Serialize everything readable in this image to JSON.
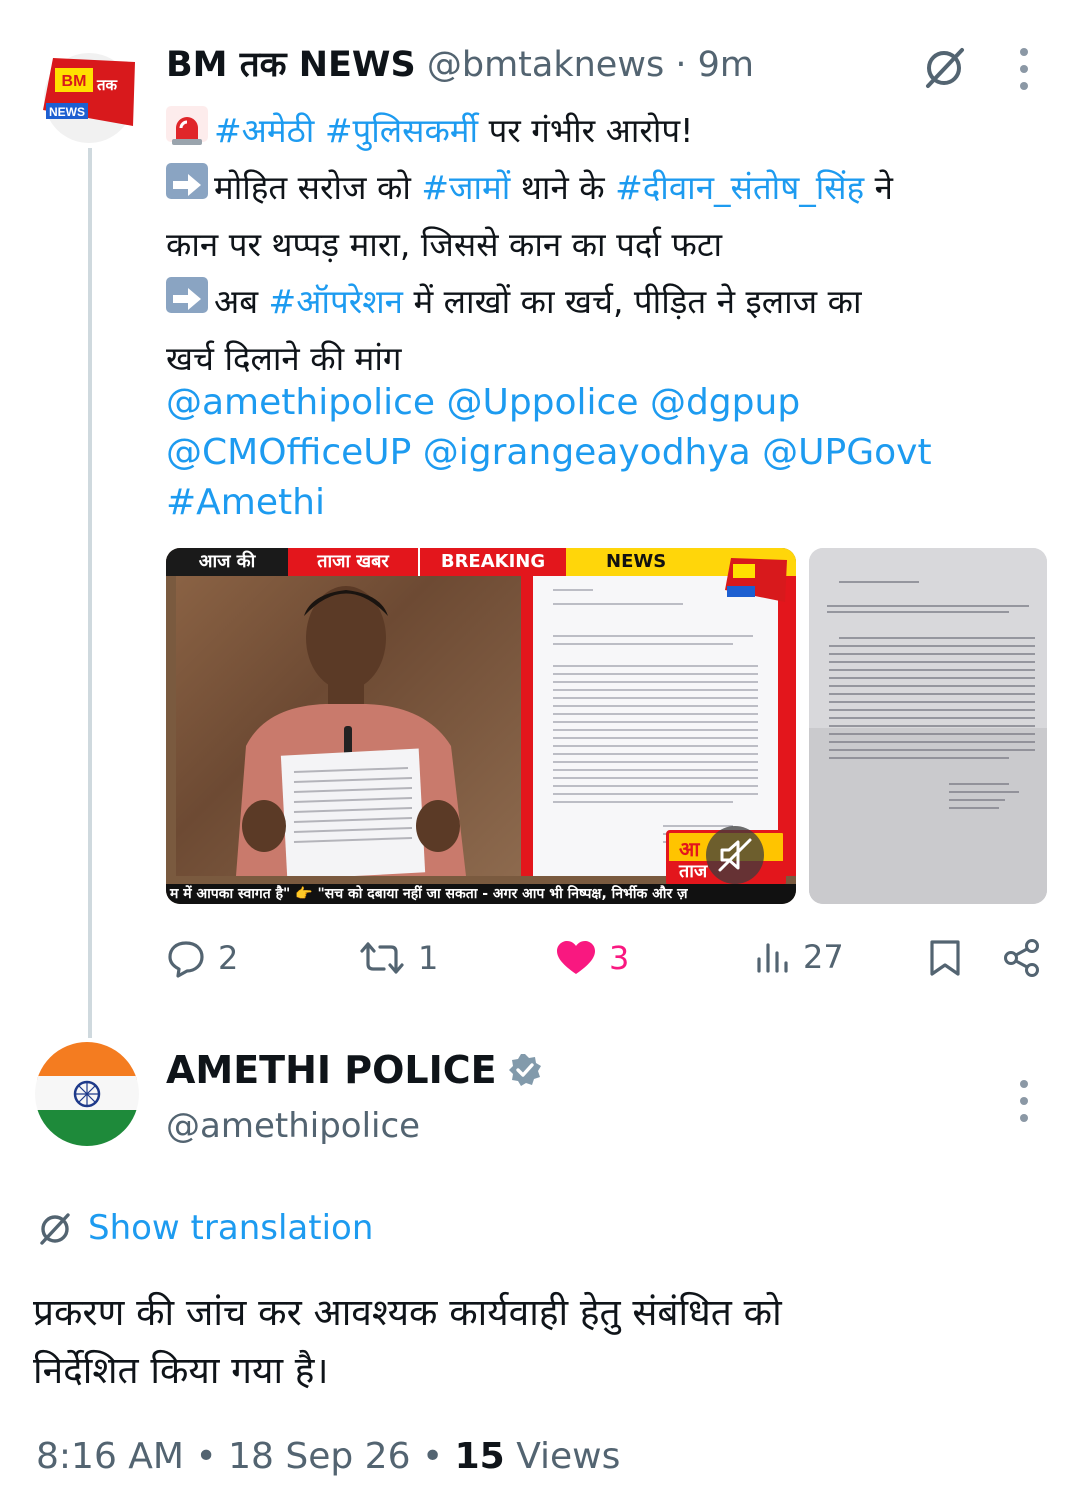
{
  "tweet": {
    "author": {
      "name": "BM तक NEWS",
      "handle": "@bmtaknews",
      "time": "9m",
      "avatar_text_top": "BM",
      "avatar_text_mid": "तक",
      "avatar_text_bottom": "NEWS"
    },
    "body": {
      "line1": {
        "tag1": "#अमेठी",
        "tag2": "#पुलिसकर्मी",
        "rest": " पर गंभीर आरोप!"
      },
      "line2": {
        "pre": "मोहित सरोज को ",
        "tag1": "#जामों",
        "mid": " थाने के ",
        "tag2": "#दीवान_संतोष_सिंह",
        "post": " ने"
      },
      "line3": "कान पर थप्पड़ मारा, जिससे कान का पर्दा फटा",
      "line4": {
        "pre": "अब ",
        "tag": "#ऑपरेशन",
        "post": " में लाखों का खर्च, पीड़ित ने इलाज का"
      },
      "line5": "खर्च दिलाने की मांग"
    },
    "mentions": {
      "line1": "@amethipolice @Uppolice @dgpup",
      "line2": "@CMOfficeUP @igrangeayodhya @UPGovt",
      "line3": "#Amethi"
    },
    "media_banner": {
      "seg1": "आज की",
      "seg2": "ताजा खबर",
      "seg3": "BREAKING",
      "seg4": "NEWS",
      "ticker": "म में आपका स्वागत है\" 👉 \"सच को दबाया नहीं जा सकता - अगर आप भी निष्पक्ष, निर्भीक और ज़",
      "overlay_text_top": "आ",
      "overlay_text_bottom": "ताज"
    },
    "actions": {
      "replies": "2",
      "retweets": "1",
      "likes": "3",
      "views": "27"
    }
  },
  "reply": {
    "author": {
      "name": "AMETHI POLICE",
      "handle": "@amethipolice",
      "verified": true
    },
    "show_translation": "Show translation",
    "text_line1": "प्रकरण की जांच कर आवश्यक कार्यवाही हेतु संबंधित को",
    "text_line2": "निर्देशित किया गया है।",
    "meta": {
      "time": "8:16 AM",
      "date": "18 Sep 26",
      "views_count": "15",
      "views_label": "Views"
    }
  },
  "icons": {
    "siren": "siren-emoji-icon",
    "arrow": "right-arrow-emoji-icon",
    "grok": "grok-icon",
    "more": "more-icon",
    "reply": "reply-icon",
    "retweet": "retweet-icon",
    "like": "heart-icon",
    "views": "views-icon",
    "bookmark": "bookmark-icon",
    "share": "share-icon",
    "verified": "verified-badge-icon",
    "translate": "translate-icon",
    "mute": "mute-icon"
  },
  "colors": {
    "link": "#1d9bf0",
    "text": "#0f1419",
    "muted": "#536471",
    "like": "#f91880",
    "verified": "#829aab"
  }
}
